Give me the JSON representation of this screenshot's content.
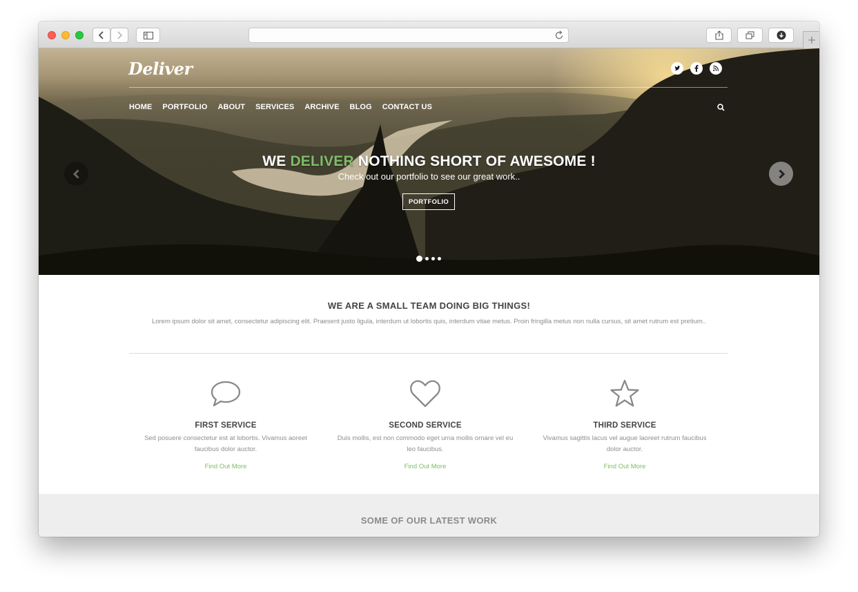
{
  "site": {
    "logo": "Deliver",
    "nav": [
      "HOME",
      "PORTFOLIO",
      "ABOUT",
      "SERVICES",
      "ARCHIVE",
      "BLOG",
      "CONTACT US"
    ],
    "social_icons": [
      "twitter-icon",
      "facebook-icon",
      "rss-icon"
    ]
  },
  "hero": {
    "headline_pre": "WE ",
    "headline_accent": "DELIVER",
    "headline_post": " NOTHING SHORT OF AWESOME !",
    "subline": "Check out our portfolio to see our great work..",
    "button_label": "PORTFOLIO",
    "slide_count": 4,
    "active_slide": 1
  },
  "intro": {
    "title": "WE ARE A SMALL TEAM DOING BIG THINGS!",
    "text": "Lorem ipsum dolor sit amet, consectetur adipiscing elit. Praesent justo ligula, interdum ut lobortis quis, interdum vitae metus. Proin fringilla metus non nulla cursus, sit amet rutrum est pretium.."
  },
  "services": [
    {
      "icon": "speech-bubble-icon",
      "title": "FIRST SERVICE",
      "text_line1": "Sed posuere consectetur est at lobortis. Vivamus aoreet",
      "text_line2": "faucibus dolor auctor.",
      "link": "Find Out More"
    },
    {
      "icon": "heart-icon",
      "title": "SECOND SERVICE",
      "text_line1": "Duis mollis, est non commodo eget urna mollis ornare vel eu",
      "text_line2": "leo faucibus.",
      "link": "Find Out More"
    },
    {
      "icon": "star-icon",
      "title": "THIRD SERVICE",
      "text_line1": "Vivamus sagittis lacus vel augue laoreet rutrum faucibus",
      "text_line2": "dolor auctor.",
      "link": "Find Out More"
    }
  ],
  "latest": {
    "title": "SOME OF OUR LATEST WORK"
  },
  "colors": {
    "accent": "#7ebc6a",
    "heading": "#444444",
    "muted": "#8c8c8c"
  }
}
